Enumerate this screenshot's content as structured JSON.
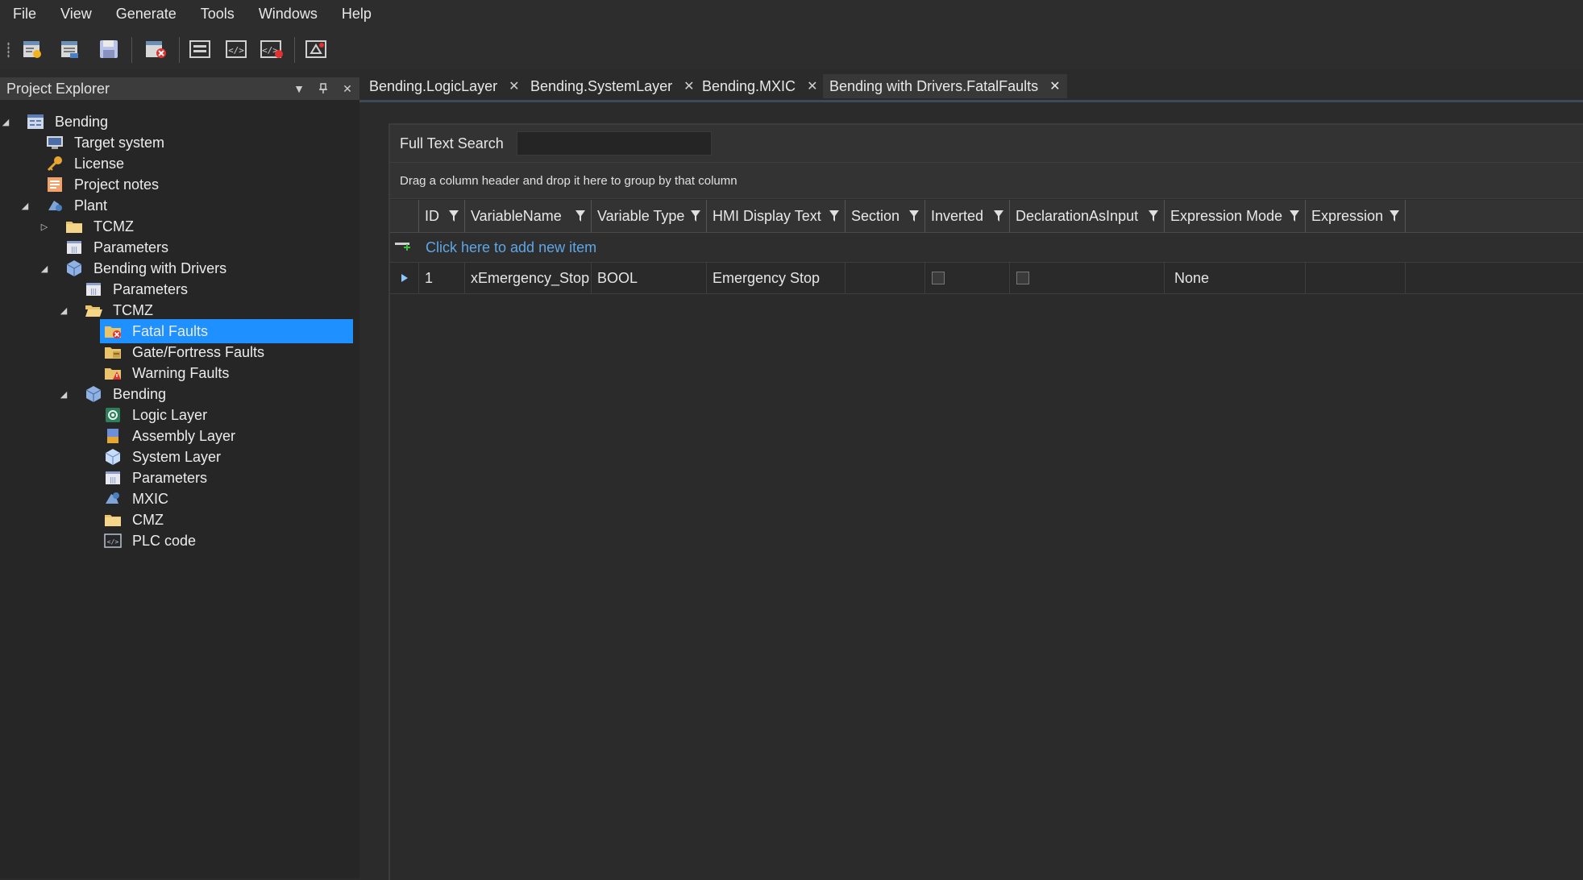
{
  "menu": [
    "File",
    "View",
    "Generate",
    "Tools",
    "Windows",
    "Help"
  ],
  "explorer": {
    "title": "Project Explorer",
    "tree": [
      {
        "label": "Bending",
        "icon": "project-icon",
        "expanded": true
      },
      {
        "label": "Target system",
        "icon": "target-system-icon"
      },
      {
        "label": "License",
        "icon": "key-icon"
      },
      {
        "label": "Project notes",
        "icon": "notes-icon"
      },
      {
        "label": "Plant",
        "icon": "plant-icon",
        "expanded": true
      },
      {
        "label": "TCMZ",
        "icon": "folder-icon",
        "expanded": false
      },
      {
        "label": "Parameters",
        "icon": "parameters-icon"
      },
      {
        "label": "Bending with Drivers",
        "icon": "cube-icon",
        "expanded": true
      },
      {
        "label": "Parameters",
        "icon": "parameters-icon"
      },
      {
        "label": "TCMZ",
        "icon": "folder-open-icon",
        "expanded": true
      },
      {
        "label": "Fatal Faults",
        "icon": "fatal-fault-icon",
        "selected": true
      },
      {
        "label": "Gate/Fortress Faults",
        "icon": "gate-fault-icon"
      },
      {
        "label": "Warning Faults",
        "icon": "warning-fault-icon"
      },
      {
        "label": "Bending",
        "icon": "cube-icon",
        "expanded": true
      },
      {
        "label": "Logic Layer",
        "icon": "logic-layer-icon"
      },
      {
        "label": "Assembly Layer",
        "icon": "assembly-layer-icon"
      },
      {
        "label": "System Layer",
        "icon": "system-layer-icon"
      },
      {
        "label": "Parameters",
        "icon": "parameters-icon"
      },
      {
        "label": "MXIC",
        "icon": "mxic-icon"
      },
      {
        "label": "CMZ",
        "icon": "folder-icon"
      },
      {
        "label": "PLC code",
        "icon": "plc-code-icon"
      }
    ]
  },
  "tabs": [
    {
      "label": "Bending.LogicLayer"
    },
    {
      "label": "Bending.SystemLayer"
    },
    {
      "label": "Bending.MXIC"
    },
    {
      "label": "Bending with Drivers.FatalFaults",
      "active": true
    }
  ],
  "grid": {
    "search_label": "Full Text Search",
    "search_value": "",
    "group_hint": "Drag a column header and drop it here to group by that column",
    "columns": [
      "ID",
      "VariableName",
      "Variable Type",
      "HMI Display Text",
      "Section",
      "Inverted",
      "DeclarationAsInput",
      "Expression Mode",
      "Expression"
    ],
    "add_new_label": "Click here to add new item",
    "rows": [
      {
        "ID": "1",
        "VariableName": "xEmergency_Stop",
        "Variable Type": "BOOL",
        "HMI Display Text": "Emergency Stop",
        "Section": "",
        "Inverted": false,
        "DeclarationAsInput": false,
        "Expression Mode": "None",
        "Expression": ""
      }
    ]
  },
  "colors": {
    "selection": "#1e90ff",
    "link": "#5da7e8",
    "background": "#2b2b2b"
  }
}
